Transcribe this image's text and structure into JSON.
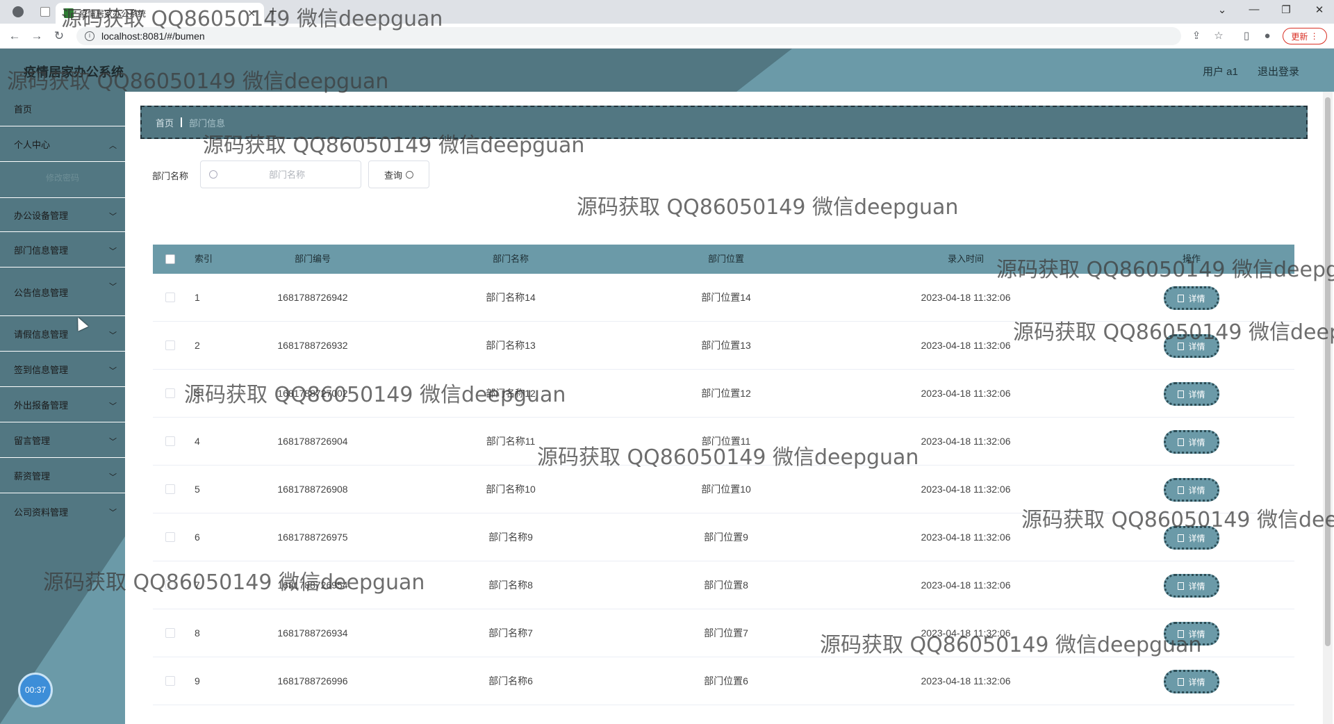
{
  "browser": {
    "tab_title": "疫情居家办公系统",
    "url": "localhost:8081/#/bumen",
    "update_label": "更新"
  },
  "app": {
    "title": "疫情居家办公系统",
    "user_label": "用户 a1",
    "logout_label": "退出登录"
  },
  "sidebar": {
    "items": [
      {
        "label": "首页"
      },
      {
        "label": "个人中心"
      },
      {
        "label": "修改密码"
      },
      {
        "label": "办公设备管理"
      },
      {
        "label": "部门信息管理"
      },
      {
        "label": "公告信息管理"
      },
      {
        "label": "请假信息管理"
      },
      {
        "label": "签到信息管理"
      },
      {
        "label": "外出报备管理"
      },
      {
        "label": "留言管理"
      },
      {
        "label": "薪资管理"
      },
      {
        "label": "公司资料管理"
      }
    ],
    "timer": "00:37"
  },
  "breadcrumb": {
    "home": "首页",
    "current": "部门信息"
  },
  "search": {
    "label": "部门名称",
    "placeholder": "部门名称",
    "button": "查询"
  },
  "table": {
    "headers": {
      "index": "索引",
      "code": "部门编号",
      "name": "部门名称",
      "location": "部门位置",
      "time": "录入时间",
      "op": "操作"
    },
    "detail_label": "详情",
    "rows": [
      {
        "index": "1",
        "code": "1681788726942",
        "name": "部门名称14",
        "location": "部门位置14",
        "time": "2023-04-18 11:32:06"
      },
      {
        "index": "2",
        "code": "1681788726932",
        "name": "部门名称13",
        "location": "部门位置13",
        "time": "2023-04-18 11:32:06"
      },
      {
        "index": "3",
        "code": "1681788727002",
        "name": "部门名称12",
        "location": "部门位置12",
        "time": "2023-04-18 11:32:06"
      },
      {
        "index": "4",
        "code": "1681788726904",
        "name": "部门名称11",
        "location": "部门位置11",
        "time": "2023-04-18 11:32:06"
      },
      {
        "index": "5",
        "code": "1681788726908",
        "name": "部门名称10",
        "location": "部门位置10",
        "time": "2023-04-18 11:32:06"
      },
      {
        "index": "6",
        "code": "1681788726975",
        "name": "部门名称9",
        "location": "部门位置9",
        "time": "2023-04-18 11:32:06"
      },
      {
        "index": "7",
        "code": "1681788726954",
        "name": "部门名称8",
        "location": "部门位置8",
        "time": "2023-04-18 11:32:06"
      },
      {
        "index": "8",
        "code": "1681788726934",
        "name": "部门名称7",
        "location": "部门位置7",
        "time": "2023-04-18 11:32:06"
      },
      {
        "index": "9",
        "code": "1681788726996",
        "name": "部门名称6",
        "location": "部门位置6",
        "time": "2023-04-18 11:32:06"
      }
    ]
  },
  "watermark": "源码获取 QQ86050149 微信deepguan",
  "colors": {
    "primary": "#527782",
    "accent": "#6b9aa8"
  }
}
